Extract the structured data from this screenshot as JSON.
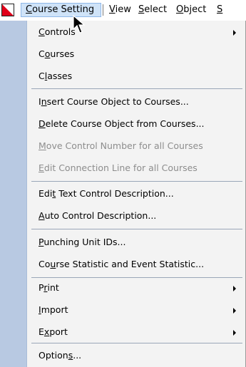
{
  "menubar": {
    "items": [
      {
        "pre": "",
        "key": "C",
        "post": "ourse Setting"
      },
      {
        "pre": "",
        "key": "V",
        "post": "iew"
      },
      {
        "pre": "",
        "key": "S",
        "post": "elect"
      },
      {
        "pre": "",
        "key": "O",
        "post": "bject"
      },
      {
        "pre": "",
        "key": "S",
        "post": ""
      }
    ],
    "active_index": 0
  },
  "menu": {
    "items": [
      {
        "pre": "",
        "key": "C",
        "post": "ontrols",
        "submenu": true,
        "enabled": true
      },
      {
        "pre": "C",
        "key": "o",
        "post": "urses",
        "submenu": false,
        "enabled": true
      },
      {
        "pre": "C",
        "key": "l",
        "post": "asses",
        "submenu": false,
        "enabled": true
      },
      {
        "pre": "I",
        "key": "n",
        "post": "sert Course Object to Courses...",
        "submenu": false,
        "enabled": true
      },
      {
        "pre": "",
        "key": "D",
        "post": "elete Course Object from Courses...",
        "submenu": false,
        "enabled": true
      },
      {
        "pre": "",
        "key": "M",
        "post": "ove Control Number for all Courses",
        "submenu": false,
        "enabled": false
      },
      {
        "pre": "",
        "key": "E",
        "post": "dit Connection Line for all Courses",
        "submenu": false,
        "enabled": false
      },
      {
        "pre": "Edi",
        "key": "t",
        "post": " Text Control Description...",
        "submenu": false,
        "enabled": true
      },
      {
        "pre": "",
        "key": "A",
        "post": "uto Control Description...",
        "submenu": false,
        "enabled": true
      },
      {
        "pre": "",
        "key": "P",
        "post": "unching Unit IDs...",
        "submenu": false,
        "enabled": true
      },
      {
        "pre": "Co",
        "key": "u",
        "post": "rse Statistic and Event Statistic...",
        "submenu": false,
        "enabled": true
      },
      {
        "pre": "P",
        "key": "r",
        "post": "int",
        "submenu": true,
        "enabled": true
      },
      {
        "pre": "",
        "key": "I",
        "post": "mport",
        "submenu": true,
        "enabled": true
      },
      {
        "pre": "E",
        "key": "x",
        "post": "port",
        "submenu": true,
        "enabled": true
      },
      {
        "pre": "Option",
        "key": "s",
        "post": "...",
        "submenu": false,
        "enabled": true
      }
    ]
  },
  "icons": {
    "app": "app-logo-icon",
    "submenu": "chevron-right-icon",
    "cursor": "mouse-pointer-icon"
  },
  "colors": {
    "menubar_active_bg": "#cfe3f8",
    "menubar_active_border": "#8fb8e8",
    "gutter": "#b8c9e2",
    "menu_bg": "#f3f3f3",
    "disabled_text": "#8d8d8d",
    "logo_red": "#e0001a"
  }
}
